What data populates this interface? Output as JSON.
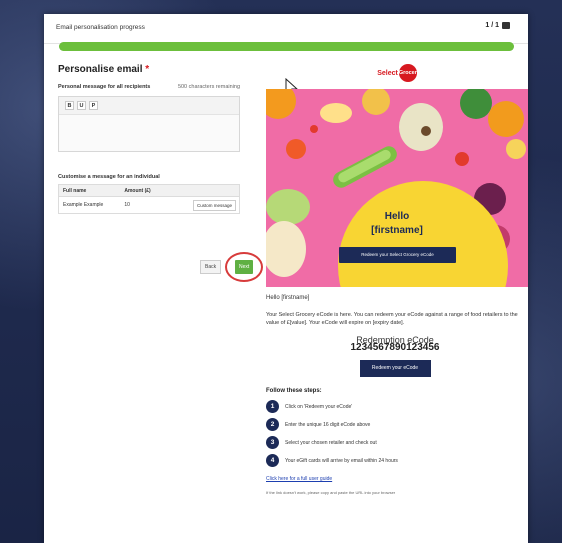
{
  "header": {
    "title": "Email personalisation progress",
    "pager": "1 / 1"
  },
  "progress": {
    "value": 1.0,
    "color": "#6cbf3c"
  },
  "form": {
    "heading": "Personalise email",
    "required_marker": "*",
    "message_label": "Personal message for all recipients",
    "chars_remaining": "500 characters remaining",
    "toolbar": {
      "bold": "B",
      "underline": "U",
      "paragraph": "P"
    },
    "customise_label": "Customise a message for an individual",
    "table": {
      "headers": [
        "Full name",
        "Amount (£)",
        ""
      ],
      "rows": [
        {
          "name": "Example Example",
          "amount": "10",
          "action": "Custom message"
        }
      ]
    },
    "back_label": "Back",
    "next_label": "Next"
  },
  "preview": {
    "logo_text": "Select",
    "logo_badge": "Grocery",
    "hero_hello": "Hello",
    "hero_name": "[firstname]",
    "hero_button": "Redeem your Select Grocery eCode",
    "greeting": "Hello [firstname]",
    "paragraph": "Your Select Grocery eCode is here. You can redeem your eCode against a range of food retailers to the value of £[value]. Your eCode will expire on [expiry date].",
    "code_label": "Redemption eCode",
    "code_value": "1234567890123456",
    "redeem_button": "Redeem your eCode",
    "steps_title": "Follow these steps:",
    "steps": [
      {
        "n": "1",
        "text": "Click on 'Redeem your eCode'"
      },
      {
        "n": "2",
        "text": "Enter the unique 16 digit eCode above"
      },
      {
        "n": "3",
        "text": "Select your chosen retailer and check out"
      },
      {
        "n": "4",
        "text": "Your eGift cards will arrive by email within 24 hours"
      }
    ],
    "guide_link": "Click here for a full user guide",
    "fine_print": "If the link doesn't work, please copy and paste the URL into your browser"
  },
  "colors": {
    "brand_red": "#d71920",
    "navy": "#1c2a57",
    "next_green": "#5fb043",
    "highlight_ring": "#d73b3b"
  }
}
